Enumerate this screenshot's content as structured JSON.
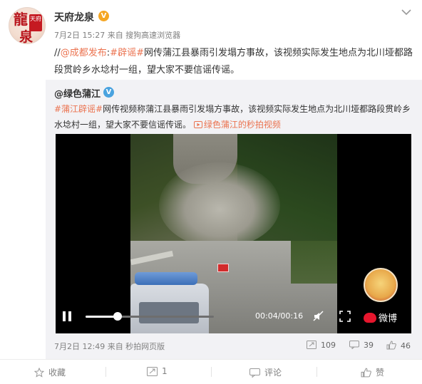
{
  "post": {
    "user_name": "天府龙泉",
    "meta": "7月2日 15:27 来自 搜狗高速浏览器",
    "avatar_text": {
      "big1": "龍",
      "small": "天府",
      "big2": "泉"
    },
    "text_prefix": "//",
    "mention": "@成都发布",
    "text_colon": ":",
    "tag": "#辟谣#",
    "text_body": "网传蒲江县暴雨引发塌方事故，该视频实际发生地点为北川垭都路段贯岭乡水埝村一组，望大家不要信谣传谣。"
  },
  "repost": {
    "user_name": "@绿色蒲江",
    "tag": "#蒲江辟谣#",
    "text_body": "网传视频称蒲江县暴雨引发塌方事故，该视频实际发生地点为北川垭都路段贯岭乡水埝村一组，望大家不要信谣传谣。",
    "video_link": "绿色蒲江的秒拍视频",
    "footer_time": "7月2日 12:49 来自 秒拍网页版",
    "stats": {
      "reposts": "109",
      "comments": "39",
      "likes": "46"
    }
  },
  "video": {
    "time": "00:04/00:16",
    "progress": 0.25,
    "brand": "微博"
  },
  "actions": {
    "favorite": "收藏",
    "repost_count": "1",
    "comment": "评论",
    "like": "赞"
  },
  "colors": {
    "link": "#eb7350",
    "verified_orange": "#f5a623",
    "verified_blue": "#4aa3df"
  },
  "icons": [
    "verified-icon",
    "chevron-down-icon",
    "play-icon",
    "mute-icon",
    "fullscreen-icon",
    "repost-icon",
    "comment-icon",
    "like-icon",
    "favorite-icon",
    "video-link-icon"
  ]
}
